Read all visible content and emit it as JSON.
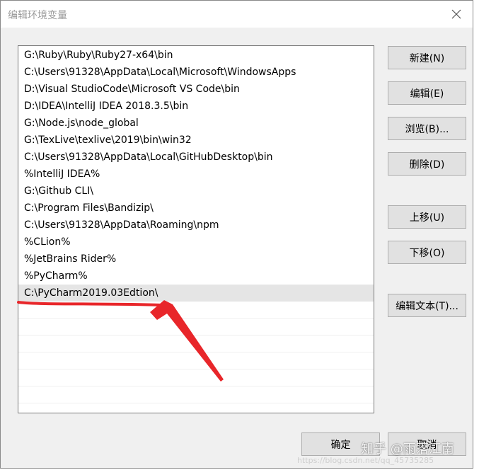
{
  "window": {
    "title": "编辑环境变量",
    "close_glyph": "✕"
  },
  "path_list": {
    "items": [
      "G:\\Ruby\\Ruby\\Ruby27-x64\\bin",
      "C:\\Users\\91328\\AppData\\Local\\Microsoft\\WindowsApps",
      "D:\\Visual StudioCode\\Microsoft VS Code\\bin",
      "D:\\IDEA\\IntelliJ IDEA 2018.3.5\\bin",
      "G:\\Node.js\\node_global",
      "G:\\TexLive\\texlive\\2019\\bin\\win32",
      "C:\\Users\\91328\\AppData\\Local\\GitHubDesktop\\bin",
      "%IntelliJ IDEA%",
      "G:\\Github CLI\\",
      "C:\\Program Files\\Bandizip\\",
      "C:\\Users\\91328\\AppData\\Roaming\\npm",
      "%CLion%",
      "%JetBrains Rider%",
      "%PyCharm%",
      "C:\\PyCharm2019.03Edtion\\"
    ],
    "selected_index": 14
  },
  "buttons": {
    "new": "新建(N)",
    "edit": "编辑(E)",
    "browse": "浏览(B)...",
    "delete": "删除(D)",
    "move_up": "上移(U)",
    "move_down": "下移(O)",
    "edit_text": "编辑文本(T)...",
    "ok": "确定",
    "cancel": "取消"
  },
  "watermark": {
    "text": "知乎 @雨落江南",
    "url": "https://blog.csdn.net/qq_45735285"
  },
  "colors": {
    "annotation": "#e8262a",
    "dialog_bg": "#f0f0f0",
    "selected_row": "#e5e5e5"
  }
}
